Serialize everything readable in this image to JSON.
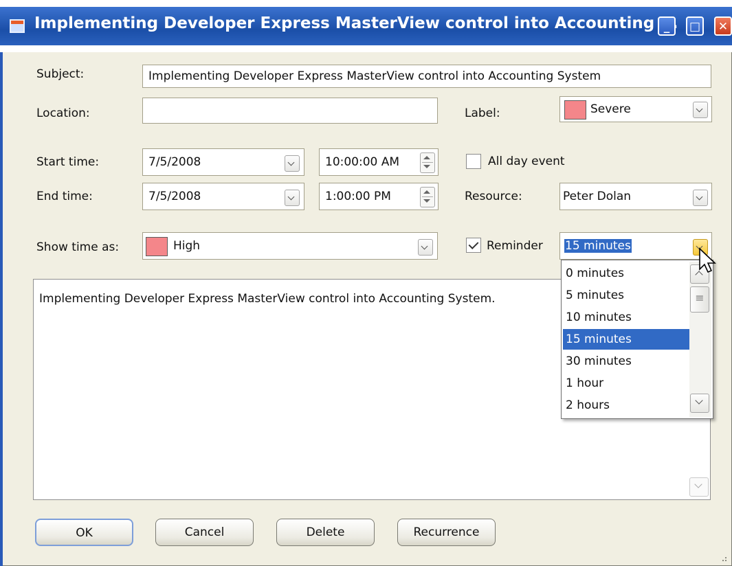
{
  "window": {
    "title": "Implementing Developer Express MasterView control into Accounting ...",
    "buttons": {
      "minimize": "_",
      "maximize": "□",
      "close": "✕"
    }
  },
  "form": {
    "subject": {
      "label": "Subject:",
      "value": "Implementing Developer Express MasterView control into Accounting System"
    },
    "location": {
      "label": "Location:",
      "value": ""
    },
    "label_field": {
      "label": "Label:",
      "value": "Severe",
      "swatch_color": "#f4868a"
    },
    "start_time": {
      "label": "Start time:",
      "date": "7/5/2008",
      "time": "10:00:00 AM"
    },
    "all_day_event": {
      "label": "All day event",
      "checked": false
    },
    "end_time": {
      "label": "End time:",
      "date": "7/5/2008",
      "time": "1:00:00 PM"
    },
    "resource": {
      "label": "Resource:",
      "value": "Peter Dolan"
    },
    "show_time_as": {
      "label": "Show time as:",
      "value": "High",
      "swatch_color": "#f4868a"
    },
    "reminder": {
      "label": "Reminder",
      "checked": true,
      "value": "15 minutes"
    }
  },
  "reminder_dropdown": {
    "selected": "15 minutes",
    "options": [
      "0 minutes",
      "5 minutes",
      "10 minutes",
      "15 minutes",
      "30 minutes",
      "1 hour",
      "2 hours"
    ]
  },
  "description": "Implementing Developer Express MasterView control into Accounting System.",
  "buttons": {
    "ok": "OK",
    "cancel": "Cancel",
    "delete": "Delete",
    "recurrence": "Recurrence"
  },
  "colors": {
    "title_bar": "#2a60bd",
    "selection": "#316ac5",
    "label_swatch": "#f4868a",
    "window_bg": "#f1efe2"
  }
}
